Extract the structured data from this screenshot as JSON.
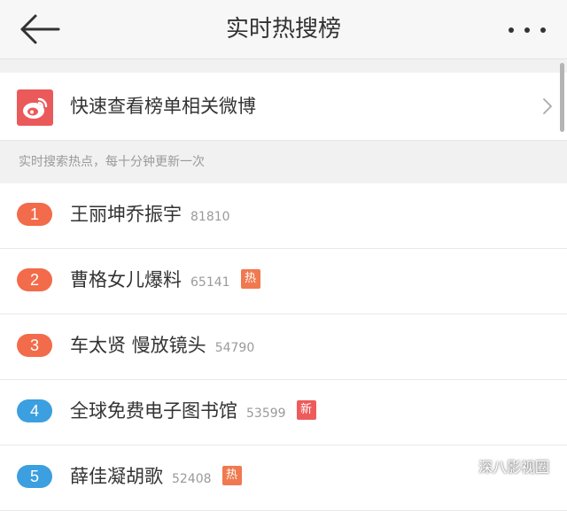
{
  "header": {
    "title": "实时热搜榜",
    "back_icon": "arrow-left-icon",
    "more_icon": "more-horizontal-icon"
  },
  "weibo_link": {
    "label": "快速查看榜单相关微博",
    "icon": "weibo-logo-icon",
    "arrow_icon": "chevron-right-icon"
  },
  "section": {
    "title": "实时搜索热点，每十分钟更新一次"
  },
  "hot_list": [
    {
      "rank": "1",
      "title": "王丽坤乔振宇",
      "count": "81810",
      "badge": "",
      "rank_color": "#f26b4a"
    },
    {
      "rank": "2",
      "title": "曹格女儿爆料",
      "count": "65141",
      "badge": "热",
      "badge_color": "#f0794f",
      "rank_color": "#f26b4a"
    },
    {
      "rank": "3",
      "title": "车太贤 慢放镜头",
      "count": "54790",
      "badge": "",
      "rank_color": "#f26b4a"
    },
    {
      "rank": "4",
      "title": "全球免费电子图书馆",
      "count": "53599",
      "badge": "新",
      "badge_color": "#ee5b5b",
      "rank_color": "#3b9fe0"
    },
    {
      "rank": "5",
      "title": "薛佳凝胡歌",
      "count": "52408",
      "badge": "热",
      "badge_color": "#f0794f",
      "rank_color": "#3b9fe0"
    }
  ],
  "watermark": {
    "text": "深八影视圈",
    "icon": "wechat-icon"
  },
  "colors": {
    "weibo_red": "#ea5a5a",
    "rank_hot": "#f26b4a",
    "rank_normal": "#3b9fe0"
  }
}
